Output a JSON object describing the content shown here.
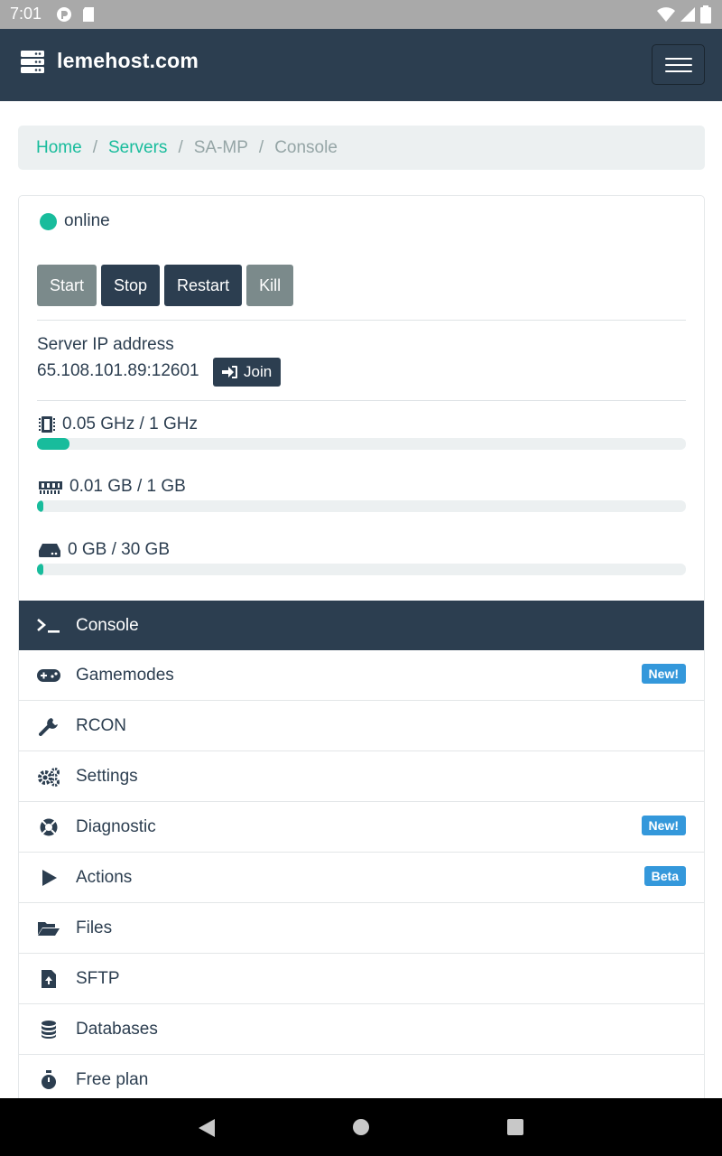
{
  "status_bar": {
    "time": "7:01"
  },
  "navbar": {
    "brand": "lemehost.com"
  },
  "breadcrumb": {
    "home": "Home",
    "servers": "Servers",
    "game": "SA-MP",
    "current": "Console"
  },
  "server": {
    "status": "online",
    "status_color": "#18bc9c",
    "buttons": {
      "start": "Start",
      "stop": "Stop",
      "restart": "Restart",
      "kill": "Kill"
    },
    "ip_label": "Server IP address",
    "ip_value": "65.108.101.89:12601",
    "join_label": "Join"
  },
  "resources": {
    "cpu": {
      "label": "0.05 GHz / 1 GHz",
      "fraction": 0.05
    },
    "ram": {
      "label": "0.01 GB / 1 GB",
      "fraction": 0.01
    },
    "disk": {
      "label": "0 GB / 30 GB",
      "fraction": 0.0
    }
  },
  "menu": {
    "items": [
      {
        "label": "Console",
        "icon": "terminal-icon"
      },
      {
        "label": "Gamemodes",
        "icon": "gamepad-icon",
        "badge": "New!"
      },
      {
        "label": "RCON",
        "icon": "wrench-icon"
      },
      {
        "label": "Settings",
        "icon": "cogs-icon"
      },
      {
        "label": "Diagnostic",
        "icon": "life-ring-icon",
        "badge": "New!"
      },
      {
        "label": "Actions",
        "icon": "play-icon",
        "badge": "Beta"
      },
      {
        "label": "Files",
        "icon": "folder-open-icon"
      },
      {
        "label": "SFTP",
        "icon": "file-upload-icon"
      },
      {
        "label": "Databases",
        "icon": "database-icon"
      },
      {
        "label": "Free plan",
        "icon": "stopwatch-icon"
      }
    ]
  },
  "colors": {
    "primary": "#2c3e50",
    "success": "#18bc9c",
    "info": "#3498db",
    "secondary": "#7b8a8b"
  }
}
